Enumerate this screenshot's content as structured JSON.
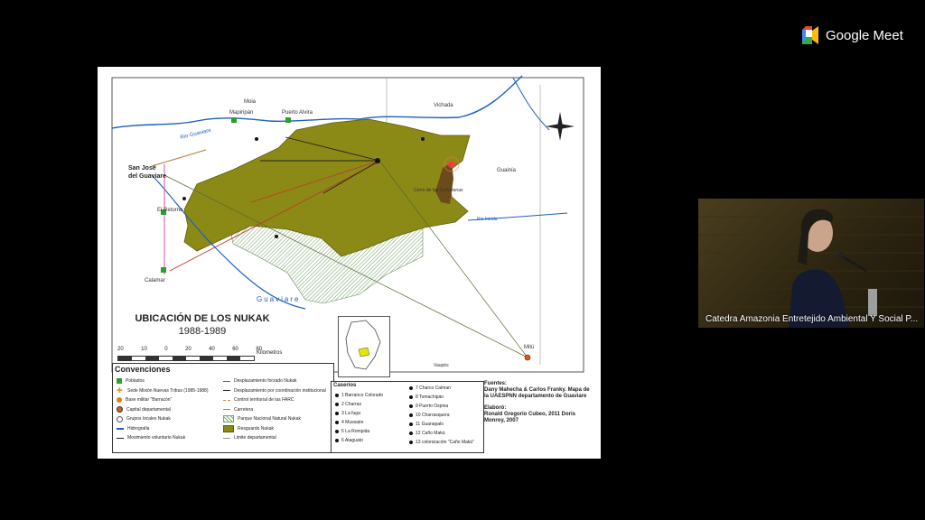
{
  "app": {
    "brand": "Google Meet",
    "logo_icon": "google-meet-logo-icon"
  },
  "slide": {
    "title": "UBICACIÓN DE LOS NUKAK",
    "years": "1988-1989",
    "scale": {
      "labels": [
        "20",
        "10",
        "0",
        "20",
        "40",
        "60",
        "80"
      ],
      "unit": "Kilometros"
    },
    "places": {
      "moia": "Moia",
      "mapiripan": "Mapiripán",
      "puerto_alvira": "Puerto Alvira",
      "vichada": "Vichada",
      "rio_guaviare_top": "Rio Guaviare",
      "san_jose": "San José",
      "del_guaviare": "del Guaviare",
      "el_retorno": "El Retorno",
      "calamar": "Calamar",
      "cerro": "Cerro de las Cerbatanas",
      "guainia": "Guainía",
      "rio_inirida": "Rio Inirida",
      "guaviare": "Guaviare",
      "mitu": "Mitú",
      "vaupes": "Vaupés"
    },
    "legend": {
      "title": "Convenciones",
      "left": [
        {
          "label": "Poblados",
          "icon": "green-square-icon"
        },
        {
          "label": "Sede Misión Nuevas Tribus (1985-1988)",
          "icon": "yellow-cross-icon"
        },
        {
          "label": "Base militar \"Barracón\"",
          "icon": "orange-dot-icon"
        },
        {
          "label": "Capital departamental",
          "icon": "capital-dot-icon"
        },
        {
          "label": "Grupos locales Nukak",
          "icon": "circle-icon"
        },
        {
          "label": "Hidrografia",
          "icon": "river-line-icon"
        },
        {
          "label": "Movimiento voluntario Nukak",
          "icon": "arrow-icon"
        }
      ],
      "right": [
        {
          "label": "Desplazamiento forzado Nukak",
          "icon": "red-arrow-icon"
        },
        {
          "label": "Desplazamiento por coordinación institucional",
          "icon": "black-arrow-icon"
        },
        {
          "label": "Control territorial de las FARC",
          "icon": "dashed-line-icon"
        },
        {
          "label": "Carretera",
          "icon": "road-line-icon"
        },
        {
          "label": "Parque Nacional Natural Nukak",
          "icon": "hatch-icon"
        },
        {
          "label": "Resguardo Nukak",
          "icon": "olive-fill-icon"
        },
        {
          "label": "Limite departamental",
          "icon": "boundary-icon"
        }
      ]
    },
    "caserios": {
      "title": "Caserios",
      "left": [
        "1 Barranco Colorado",
        "2 Charras",
        "3 La fuga",
        "4 Mussaire",
        "5 La Rompida",
        "6 Ataguato"
      ],
      "right": [
        "7 Charco Caiman",
        "8 Tomachipán",
        "9 Puerto Ospina",
        "10 Charrasquera",
        "11 Guanapalo",
        "12 Caño Makú",
        "13 colonización \"Caño Makú\""
      ]
    },
    "sources": {
      "fuentes_label": "Fuentes:",
      "fuentes_text": "Dany Mahecha & Carlos Franky. Mapa de la UAESPNN departamento de Guaviare",
      "elaboro_label": "Elaboró:",
      "elaboro_text": "Ronald Gregorio Cubeo, 2011 Doris Monroy, 2007"
    }
  },
  "participant": {
    "name": "Catedra Amazonia Entretejido Ambiental Y Social P..."
  },
  "colors": {
    "olive": "#8c8a16",
    "park_hatch": "#a8c8a0",
    "river": "#1f5fbf",
    "background": "#000000"
  }
}
